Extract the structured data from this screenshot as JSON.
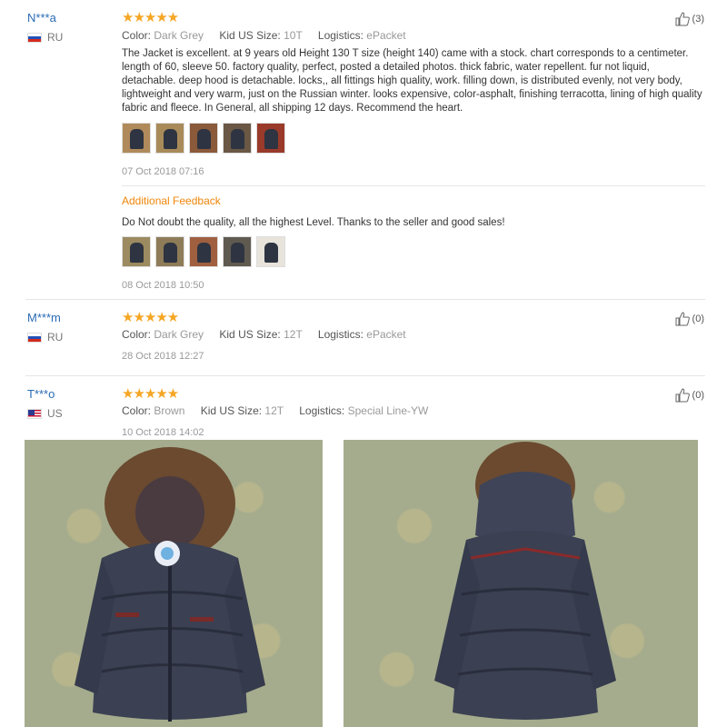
{
  "reviews": [
    {
      "user": "N***a",
      "country": "RU",
      "stars": "★★★★★",
      "color_label": "Color:",
      "color": "Dark Grey",
      "size_label": "Kid US Size:",
      "size": "10T",
      "logistics_label": "Logistics:",
      "logistics": "ePacket",
      "text": "The Jacket is excellent. at 9 years old Height 130 T size (height 140) came with a stock. chart corresponds to a centimeter. length of 60, sleeve 50. factory quality, perfect, posted a detailed photos. thick fabric, water repellent. fur not liquid, detachable. deep hood is detachable. locks,, all fittings high quality, work. filling down, is distributed evenly, not very body, lightweight and very warm, just on the Russian winter. looks expensive, color-asphalt, finishing terracotta, lining of high quality fabric and fleece. In General, all shipping 12 days. Recommend the heart.",
      "date": "07 Oct 2018 07:16",
      "helpful": "(3)",
      "additional_label": "Additional Feedback",
      "additional_text": "Do Not doubt the quality, all the highest Level. Thanks to the seller and good sales!",
      "additional_date": "08 Oct 2018 10:50"
    },
    {
      "user": "M***m",
      "country": "RU",
      "stars": "★★★★★",
      "color_label": "Color:",
      "color": "Dark Grey",
      "size_label": "Kid US Size:",
      "size": "12T",
      "logistics_label": "Logistics:",
      "logistics": "ePacket",
      "date": "28 Oct 2018 12:27",
      "helpful": "(0)"
    },
    {
      "user": "T***o",
      "country": "US",
      "stars": "★★★★★",
      "color_label": "Color:",
      "color": "Brown",
      "size_label": "Kid US Size:",
      "size": "12T",
      "logistics_label": "Logistics:",
      "logistics": "Special Line-YW",
      "date": "10 Oct 2018 14:02",
      "helpful": "(0)"
    }
  ],
  "colors": {
    "user": "#2a6bb5",
    "star": "#f5a623",
    "additional": "#f0860a"
  }
}
